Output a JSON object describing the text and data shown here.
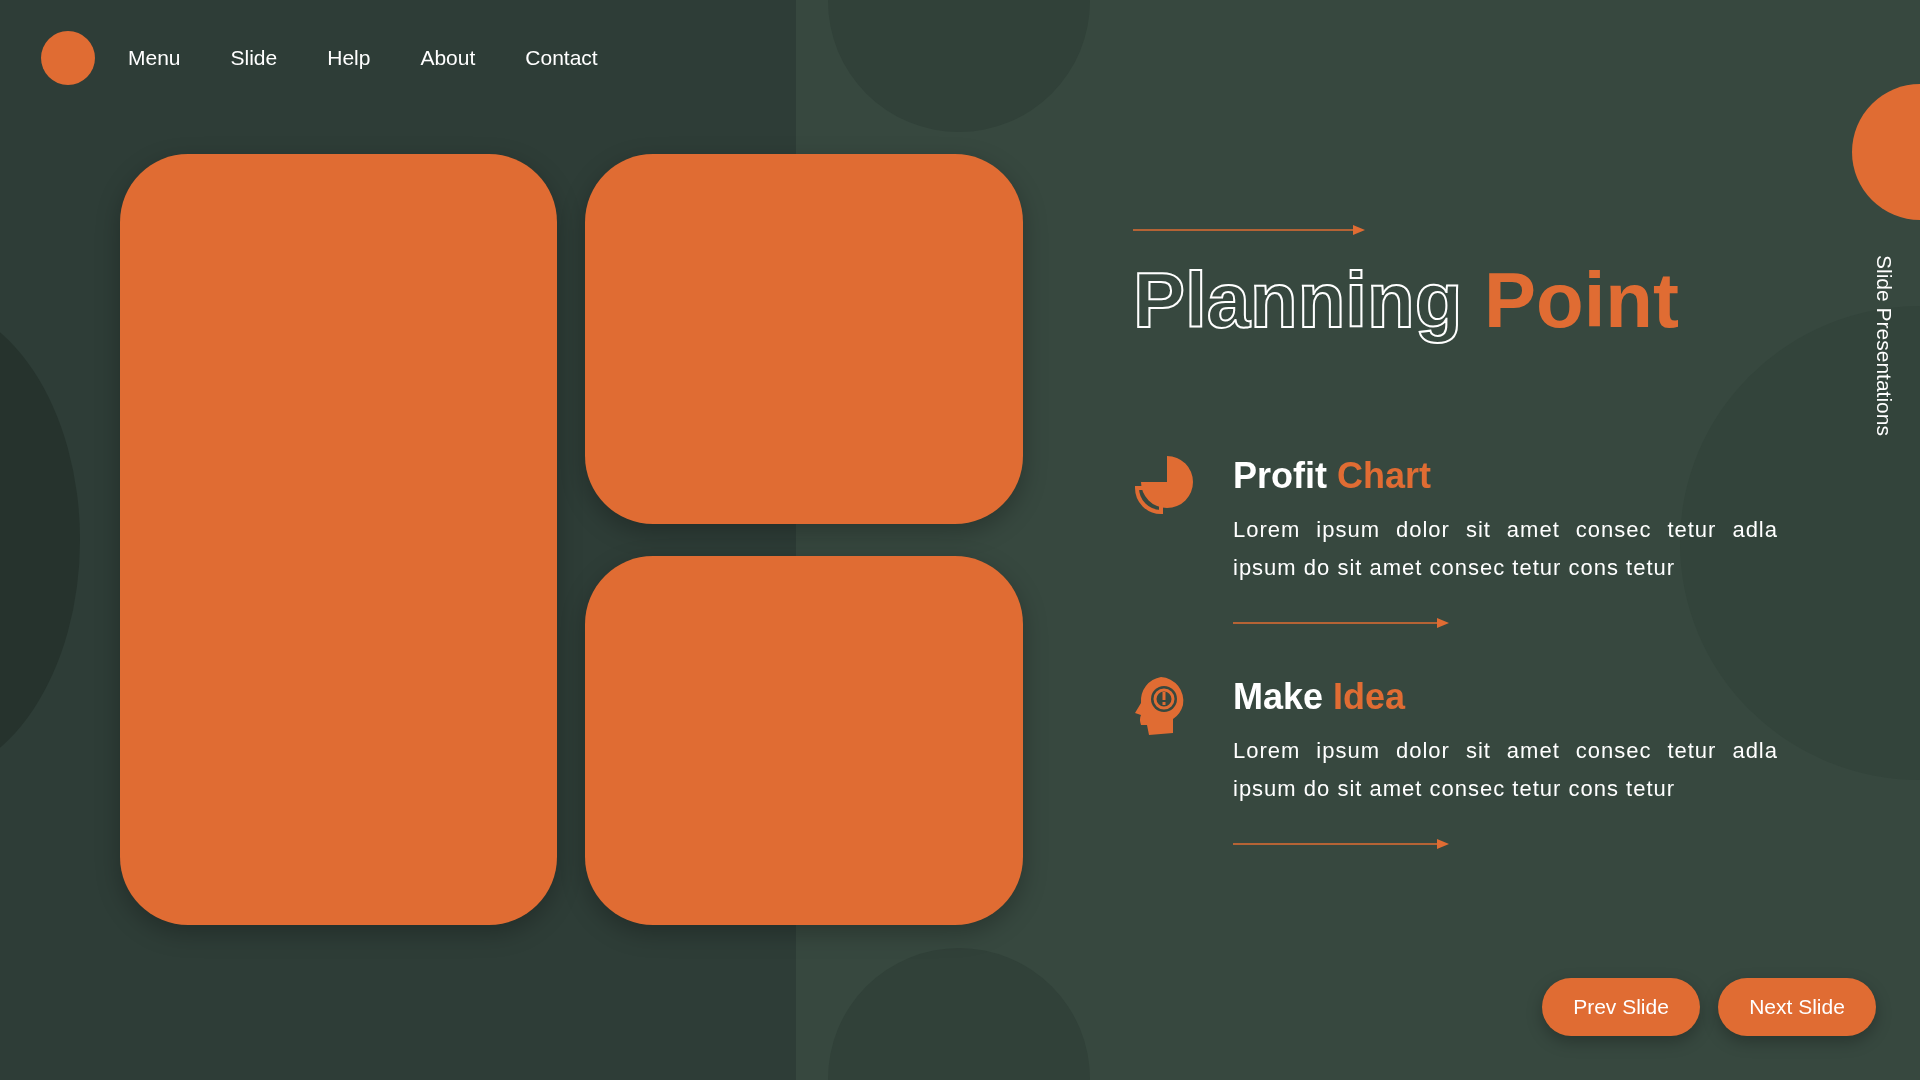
{
  "nav": {
    "items": [
      {
        "label": "Menu"
      },
      {
        "label": "Slide"
      },
      {
        "label": "Help"
      },
      {
        "label": "About"
      },
      {
        "label": "Contact"
      }
    ]
  },
  "title": "Planning **Point**",
  "features": [
    {
      "kind": "chart",
      "heading": "Profit **Chart**",
      "text": "Lorem ipsum dolor sit amet consec tetur adla ipsum do sit amet consec tetur cons tetur"
    },
    {
      "kind": "idea",
      "heading": "Make **Idea**",
      "text": "Lorem ipsum dolor sit amet consec tetur adla ipsum do sit amet consec tetur cons tetur"
    }
  ],
  "side_label": "Slide Presentations",
  "buttons": [
    "Prev Slide",
    "Next Slide"
  ]
}
